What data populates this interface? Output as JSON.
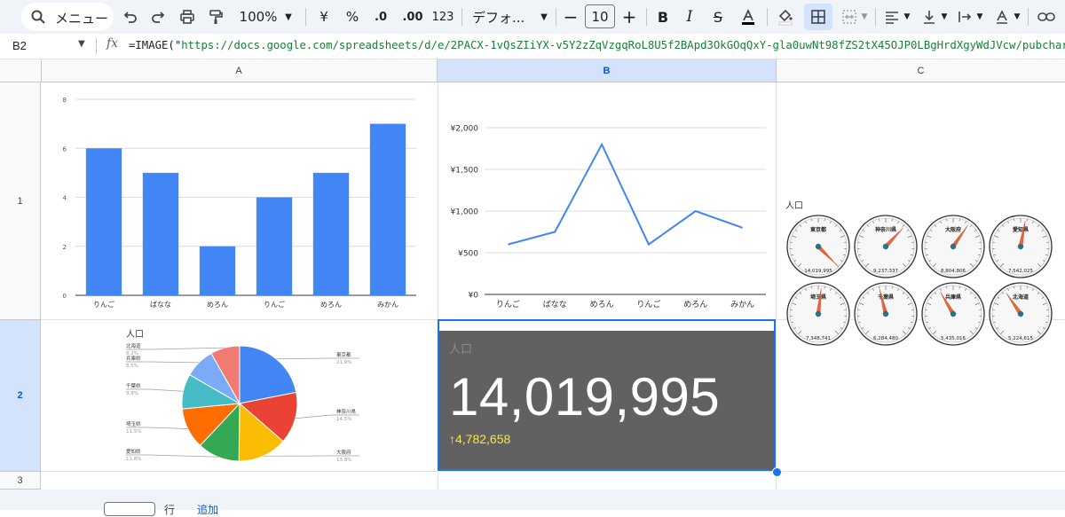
{
  "toolbar": {
    "menu_label": "メニュー",
    "zoom": "100%",
    "currency": "¥",
    "percent": "%",
    "decimal_decrease": ".0",
    "decimal_increase": ".00",
    "number_format": "123",
    "font_family": "デフォ...",
    "font_size": "10"
  },
  "formula_bar": {
    "cell_ref": "B2",
    "formula_prefix": "=IMAGE(\"",
    "formula_url": "https://docs.google.com/spreadsheets/d/e/2PACX-1vQsZIiYX-v5Y2zZqVzgqRoL8U5f2BApd3OkGOqQxY-gla0uwNt98fZS2tX45OJP0LBgHrdXgyWdJVcw/pubchart"
  },
  "grid": {
    "columns": [
      "A",
      "B",
      "C"
    ],
    "rows": [
      "1",
      "2",
      "3"
    ],
    "selected_col": "B",
    "selected_row": "2"
  },
  "chart_data": [
    {
      "type": "bar",
      "categories": [
        "りんご",
        "ばなな",
        "めろん",
        "りんご",
        "めろん",
        "みかん"
      ],
      "values": [
        6,
        5,
        2,
        4,
        5,
        7
      ],
      "ylim": [
        0,
        8
      ],
      "yticks": [
        "0",
        "2",
        "4",
        "6",
        "8"
      ],
      "color": "#4285f4",
      "grid": true
    },
    {
      "type": "line",
      "categories": [
        "りんご",
        "ばなな",
        "めろん",
        "りんご",
        "めろん",
        "みかん"
      ],
      "values": [
        600,
        750,
        1800,
        600,
        1000,
        800
      ],
      "ylim": [
        0,
        2000
      ],
      "yticks": [
        "¥0",
        "¥500",
        "¥1,000",
        "¥1,500",
        "¥2,000"
      ],
      "color": "#4285f4",
      "grid": true
    },
    {
      "type": "pie",
      "title": "人口",
      "slices": [
        {
          "name": "東京都",
          "pct": "21.9%",
          "value": 21.9,
          "color": "#4285f4"
        },
        {
          "name": "神奈川県",
          "pct": "14.5%",
          "value": 14.5,
          "color": "#ea4335"
        },
        {
          "name": "大阪府",
          "pct": "13.8%",
          "value": 13.8,
          "color": "#fbbc04"
        },
        {
          "name": "愛知県",
          "pct": "11.8%",
          "value": 11.8,
          "color": "#34a853"
        },
        {
          "name": "埼玉県",
          "pct": "11.5%",
          "value": 11.5,
          "color": "#ff6d01"
        },
        {
          "name": "千葉県",
          "pct": "9.8%",
          "value": 9.8,
          "color": "#46bdc6"
        },
        {
          "name": "兵庫県",
          "pct": "8.5%",
          "value": 8.5,
          "color": "#7baaf7"
        },
        {
          "name": "北海道",
          "pct": "8.2%",
          "value": 8.2,
          "color": "#f07b72"
        }
      ]
    },
    {
      "type": "scorecard",
      "title": "人口",
      "value": "14,019,995",
      "delta": "↑4,782,658"
    },
    {
      "type": "gauge",
      "title": "人口",
      "max": 14019995,
      "gauges": [
        {
          "name": "東京都",
          "value": "14,019,995",
          "num": 14019995
        },
        {
          "name": "神奈川県",
          "value": "9,237,337",
          "num": 9237337
        },
        {
          "name": "大阪府",
          "value": "8,804,806",
          "num": 8804806
        },
        {
          "name": "愛知県",
          "value": "7,542,025",
          "num": 7542025
        },
        {
          "name": "埼玉県",
          "value": "7,348,741",
          "num": 7348741
        },
        {
          "name": "千葉県",
          "value": "6,284,480",
          "num": 6284480
        },
        {
          "name": "兵庫県",
          "value": "5,435,016",
          "num": 5435016
        },
        {
          "name": "北海道",
          "value": "5,224,615",
          "num": 5224615
        }
      ]
    }
  ],
  "bottom": {
    "rows_label": "行",
    "add_label": "追加"
  }
}
